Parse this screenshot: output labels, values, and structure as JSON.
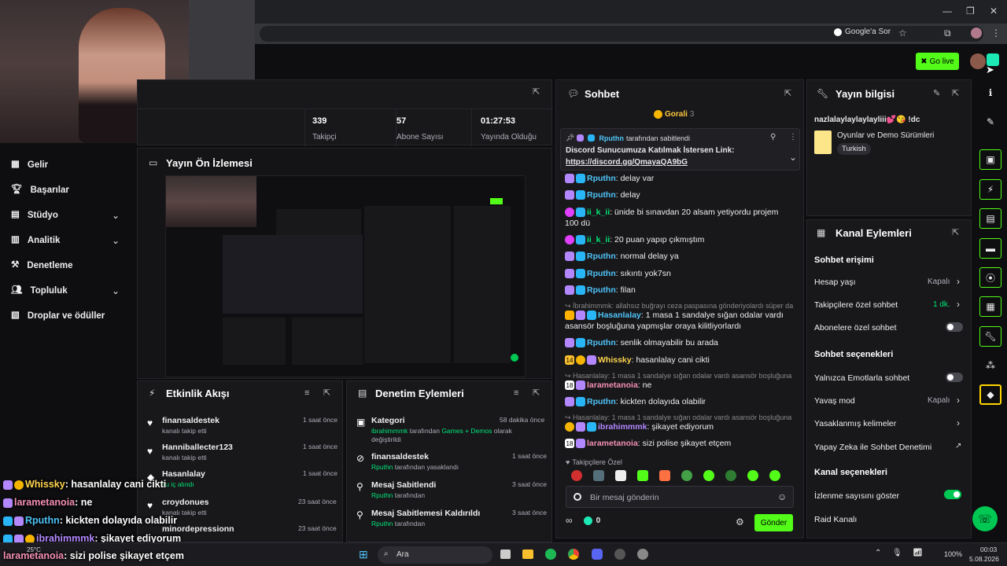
{
  "browser": {
    "google_ask": "Google'a Sor"
  },
  "header": {
    "go_live": "Go live"
  },
  "stats": [
    {
      "value": "339",
      "label": "Takipçi"
    },
    {
      "value": "57",
      "label": "Abone Sayısı"
    },
    {
      "value": "01:27:53",
      "label": "Yayında Olduğu Süre"
    }
  ],
  "sidebar": {
    "items": [
      {
        "label": "Gelir",
        "icon": "revenue-icon"
      },
      {
        "label": "Başarılar",
        "icon": "trophy-icon"
      },
      {
        "label": "Stüdyo",
        "icon": "studio-icon",
        "expandable": true
      },
      {
        "label": "Analitik",
        "icon": "analytics-icon",
        "expandable": true
      },
      {
        "label": "Denetleme",
        "icon": "moderation-icon"
      },
      {
        "label": "Topluluk",
        "icon": "community-icon",
        "expandable": true
      },
      {
        "label": "Droplar ve ödüller",
        "icon": "drops-icon"
      }
    ]
  },
  "preview": {
    "title": "Yayın Ön İzlemesi"
  },
  "activity": {
    "title": "Etkinlik Akışı",
    "items": [
      {
        "name": "finansaldestek",
        "sub": "kanalı takip etti",
        "time": "1 saat önce"
      },
      {
        "name": "Hanniballecter123",
        "sub": "kanalı takip etti",
        "time": "1 saat önce"
      },
      {
        "name": "Hasanlalay",
        "sub": "su iç alındı",
        "time": "1 saat önce"
      },
      {
        "name": "croydonues",
        "sub": "kanalı takip etti",
        "time": "23 saat önce"
      },
      {
        "name": "minordepressionn",
        "sub": "",
        "time": "23 saat önce"
      }
    ]
  },
  "modlog": {
    "title": "Denetim Eylemleri",
    "items": [
      {
        "title": "Kategori",
        "user": "ibrahimmmk",
        "text": "tarafından",
        "highlight": "Games + Demos",
        "text2": "olarak değiştirildi",
        "time": "58 dakika önce"
      },
      {
        "title": "finansaldestek",
        "user": "Rputhn",
        "text": "tarafından yasaklandı",
        "highlight": "",
        "text2": "",
        "time": "1 saat önce"
      },
      {
        "title": "Mesaj Sabitlendi",
        "user": "Rputhn",
        "text": "tarafından",
        "highlight": "",
        "text2": "",
        "time": "3 saat önce"
      },
      {
        "title": "Mesaj Sabitlemesi Kaldırıldı",
        "user": "Rputhn",
        "text": "tarafından",
        "highlight": "",
        "text2": "",
        "time": "3 saat önce"
      }
    ]
  },
  "chat": {
    "title": "Sohbet",
    "top_gifter": "Gorali",
    "top_gifter_count": "3",
    "pinned_by": "Rputhn",
    "pinned_label": "tarafından sabitlendi",
    "pinned_text": "Discord Sunucumuza Katılmak İstersen Link:",
    "pinned_link": "https://discord.gg/QmayaQA9bG",
    "messages": [
      {
        "user": "Rputhn",
        "color": "#4fc3f7",
        "text": ": delay var"
      },
      {
        "user": "Rputhn",
        "color": "#4fc3f7",
        "text": ": delay"
      },
      {
        "user": "ii_k_ii",
        "color": "#00e676",
        "text": ": ünide bi sınavdan 20 alsam yetiyordu projem 100 dü"
      },
      {
        "user": "ii_k_ii",
        "color": "#00e676",
        "text": ": 20 puan yapıp çıkmıştım"
      },
      {
        "user": "Rputhn",
        "color": "#4fc3f7",
        "text": ": normal delay ya"
      },
      {
        "user": "Rputhn",
        "color": "#4fc3f7",
        "text": ": sıkıntı yok7sn"
      },
      {
        "user": "Rputhn",
        "color": "#4fc3f7",
        "text": ": filan"
      },
      {
        "reply": "İbrahimmmk: allahsız buğrayı ceza paspasına gönderiyolardı süper da..."
      },
      {
        "user": "Hasanlalay",
        "color": "#4fc3f7",
        "text": ": 1 masa 1 sandalye sığan odalar vardı asansör boşluğuna yapmışlar oraya kilitliyorlardı"
      },
      {
        "user": "Rputhn",
        "color": "#4fc3f7",
        "text": ": senlik olmayabilir bu arada"
      },
      {
        "user": "Whissky",
        "color": "#ffd54f",
        "text": ": hasanlalay cani cikti"
      },
      {
        "reply": "Hasanlalay: 1 masa 1 sandalye sığan odalar vardı asansör boşluğuna y..."
      },
      {
        "user": "larametanoia",
        "color": "#f48fb1",
        "text": ": ne"
      },
      {
        "user": "Rputhn",
        "color": "#4fc3f7",
        "text": ": kickten dolayıda olabilir"
      },
      {
        "reply": "Hasanlalay: 1 masa 1 sandalye sığan odalar vardı asansör boşluğuna y..."
      },
      {
        "user": "ibrahimmmk",
        "color": "#b388ff",
        "text": ": şikayet ediyorum"
      },
      {
        "user": "larametanoia",
        "color": "#f48fb1",
        "text": ": sizi polise şikayet etçem"
      }
    ],
    "followers_only": "Takipçilere Özel",
    "input_placeholder": "Bir mesaj gönderin",
    "points": "0",
    "send": "Gönder"
  },
  "stream_info": {
    "title": "Yayın bilgisi",
    "stream_title": "nazlalaylaylaylayliii💕😘 !dc",
    "category": "Oyunlar ve Demo Sürümleri",
    "tag": "Turkish"
  },
  "channel_actions": {
    "title": "Kanal Eylemleri",
    "chat_access": "Sohbet erişimi",
    "account_age": "Hesap yaşı",
    "account_age_value": "Kapalı",
    "followers_chat": "Takipçilere özel sohbet",
    "followers_chat_value": "1 dk.",
    "subs_chat": "Abonelere özel sohbet",
    "chat_options": "Sohbet seçenekleri",
    "emote_only": "Yalnızca Emotlarla sohbet",
    "slow_mode": "Yavaş mod",
    "slow_mode_value": "Kapalı",
    "banned_words": "Yasaklanmış kelimeler",
    "ai_moderation": "Yapay Zeka ile Sohbet Denetimi",
    "channel_options": "Kanal seçenekleri",
    "show_viewers": "İzlenme sayısını göster",
    "raid": "Raid Kanalı"
  },
  "overlay_chat": [
    {
      "user": "Whissky",
      "color": "#ffd54f",
      "text": ": hasanlalay cani cikti"
    },
    {
      "user": "larametanoia",
      "color": "#f48fb1",
      "text": ": ne"
    },
    {
      "user": "Rputhn",
      "color": "#4fc3f7",
      "text": ": kickten dolayıda olabilir"
    },
    {
      "user": "ibrahimmmk",
      "color": "#b388ff",
      "text": ": şikayet ediyorum"
    },
    {
      "user": "larametanoia",
      "color": "#f48fb1",
      "text": ": sizi polise şikayet etçem"
    }
  ],
  "taskbar": {
    "search": "Ara",
    "temp": "25°C",
    "battery": "100%",
    "time": "00:03",
    "date": "5.08.2026"
  },
  "colors": {
    "accent": "#53fc18",
    "panel": "#18181b",
    "bg": "#0e0e10"
  }
}
